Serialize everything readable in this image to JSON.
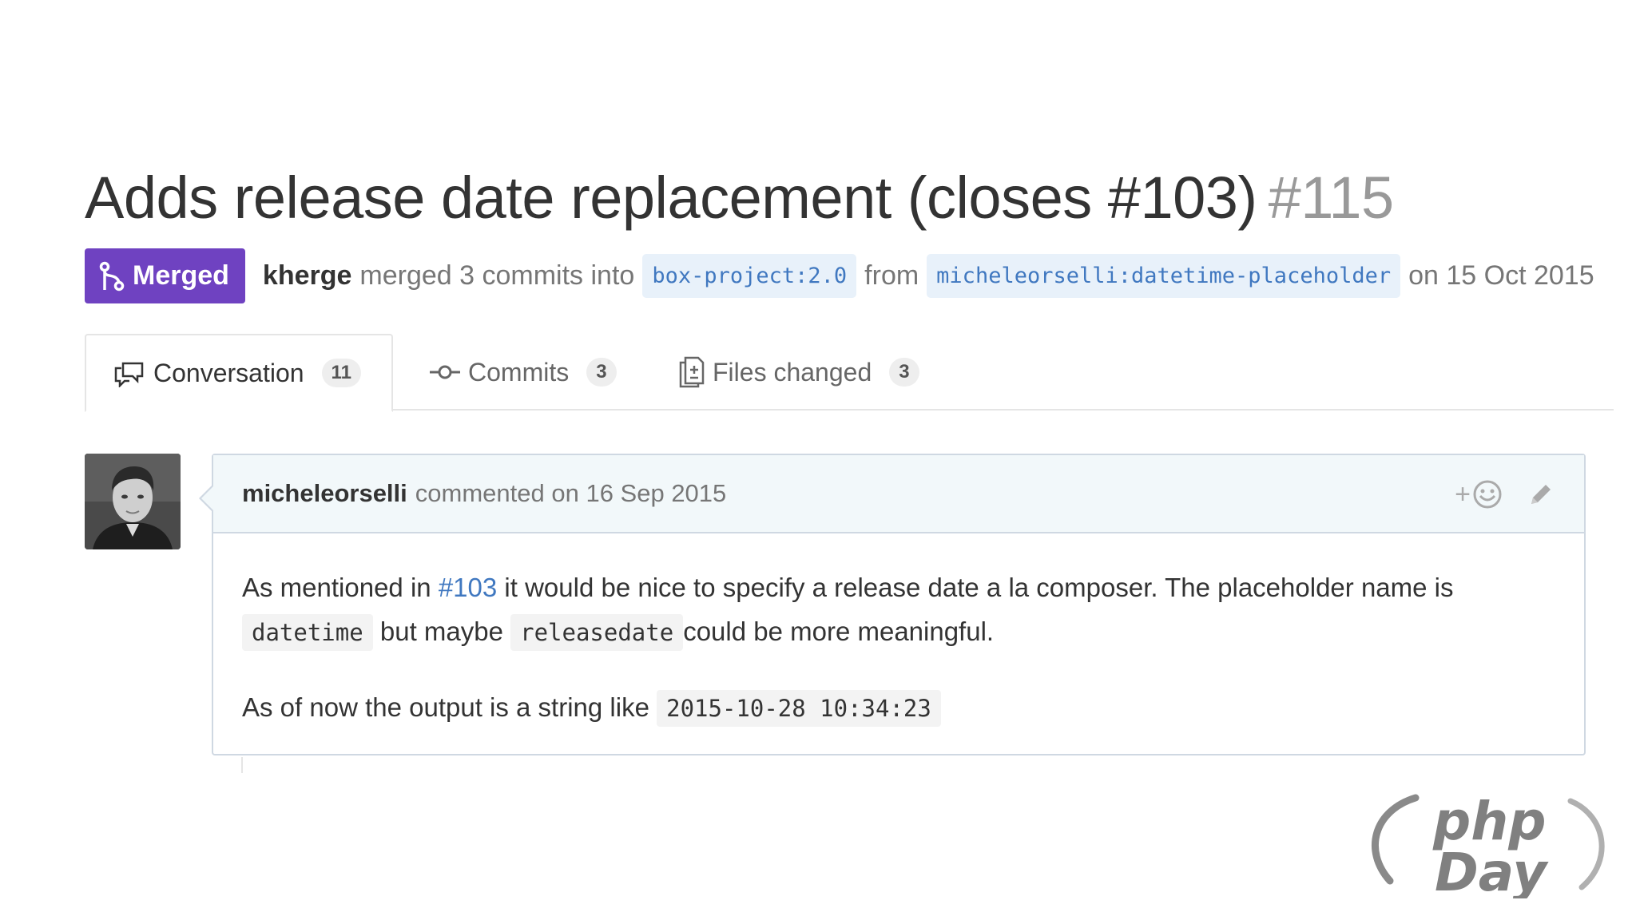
{
  "pull_request": {
    "title": "Adds release date replacement (closes #103)",
    "number": "#115",
    "state": "Merged",
    "merged_by": "kherge",
    "merge_text": "merged 3 commits into",
    "base_branch": "box-project:2.0",
    "from_text": "from",
    "head_branch": "micheleorselli:datetime-placeholder",
    "date_text": "on 15 Oct 2015"
  },
  "tabs": [
    {
      "label": "Conversation",
      "count": "11",
      "icon": "comment-discussion-icon"
    },
    {
      "label": "Commits",
      "count": "3",
      "icon": "git-commit-icon"
    },
    {
      "label": "Files changed",
      "count": "3",
      "icon": "diff-icon"
    }
  ],
  "comment": {
    "author": "micheleorselli",
    "meta": "commented on 16 Sep 2015",
    "reaction_label": "+",
    "p1_a": "As mentioned in",
    "p1_link": "#103",
    "p1_b": "it would be nice to specify a release date a la composer. The placeholder name is",
    "p1_code1": "datetime",
    "p1_c": "but maybe",
    "p1_code2": "releasedate",
    "p1_d": "could be more meaningful.",
    "p2_a": "As of now the output is a string like",
    "p2_code": "2015-10-28 10:34:23"
  },
  "logo": {
    "line1": "php",
    "line2": "Day"
  },
  "colors": {
    "merged": "#6f42c1",
    "link": "#4078c0",
    "branch_bg": "#e8f1fa",
    "header_bg": "#f2f8fa"
  }
}
